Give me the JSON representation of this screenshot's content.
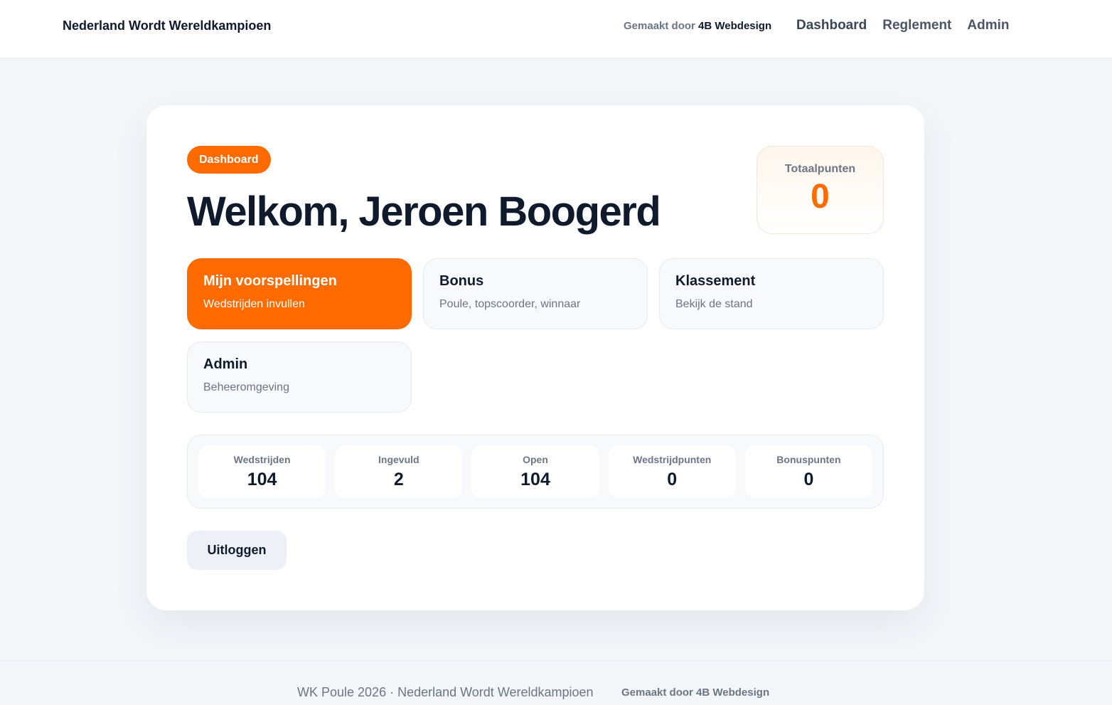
{
  "header": {
    "brand": "Nederland Wordt Wereldkampioen",
    "made_by_prefix": "Gemaakt door",
    "made_by_name": "4B Webdesign",
    "nav": [
      {
        "label": "Dashboard"
      },
      {
        "label": "Reglement"
      },
      {
        "label": "Admin"
      }
    ]
  },
  "main": {
    "badge": "Dashboard",
    "welcome": "Welkom, Jeroen Boogerd",
    "total": {
      "label": "Totaalpunten",
      "value": "0"
    },
    "tiles": [
      {
        "title": "Mijn voorspellingen",
        "subtitle": "Wedstrijden invullen"
      },
      {
        "title": "Bonus",
        "subtitle": "Poule, topscoorder, winnaar"
      },
      {
        "title": "Klassement",
        "subtitle": "Bekijk de stand"
      },
      {
        "title": "Admin",
        "subtitle": "Beheeromgeving"
      }
    ],
    "stats": [
      {
        "label": "Wedstrijden",
        "value": "104"
      },
      {
        "label": "Ingevuld",
        "value": "2"
      },
      {
        "label": "Open",
        "value": "104"
      },
      {
        "label": "Wedstrijdpunten",
        "value": "0"
      },
      {
        "label": "Bonuspunten",
        "value": "0"
      }
    ],
    "logout_label": "Uitloggen"
  },
  "footer": {
    "text": "WK Poule 2026 · Nederland Wordt Wereldkampioen",
    "made_by": "Gemaakt door 4B Webdesign"
  },
  "colors": {
    "accent": "#ff6b00",
    "text": "#0f1b2d",
    "muted": "#6b7686",
    "background": "#f4f7fa"
  }
}
